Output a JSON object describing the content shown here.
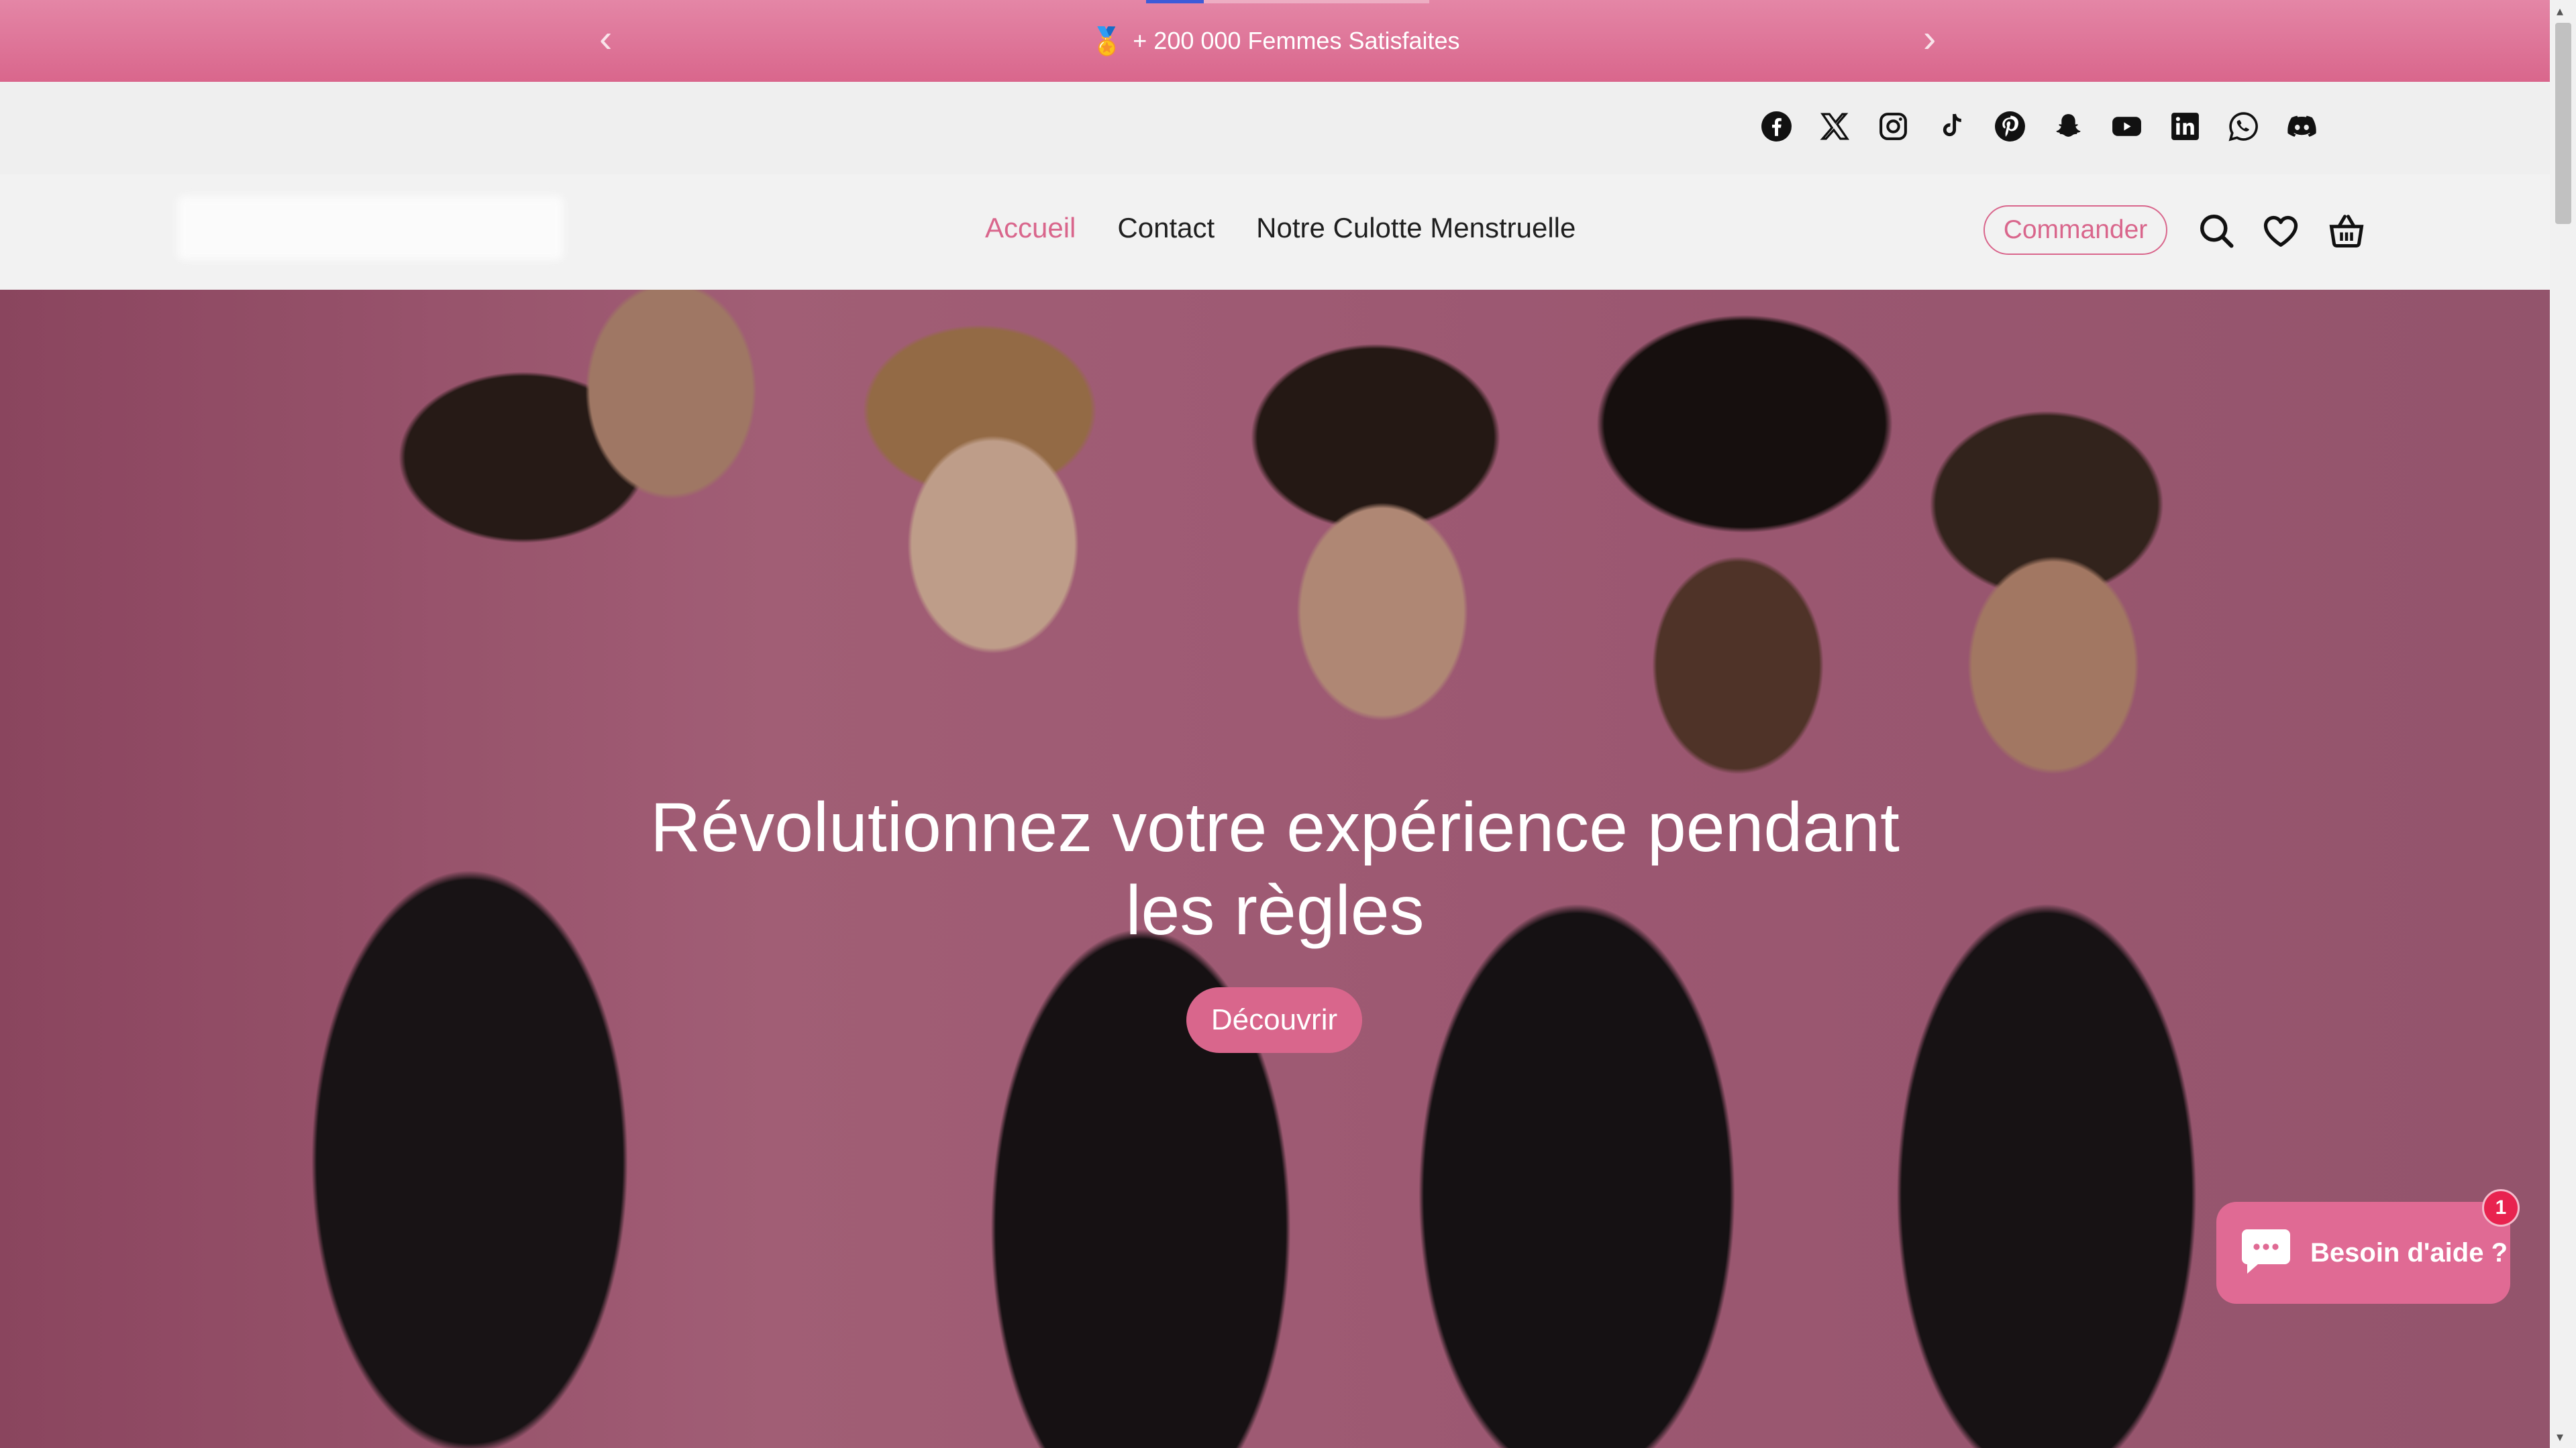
{
  "announcement": {
    "emoji": "🏅",
    "text": "+ 200 000 Femmes Satisfaites",
    "prev": "‹",
    "next": "›"
  },
  "socials": [
    "facebook-icon",
    "x-icon",
    "instagram-icon",
    "tiktok-icon",
    "pinterest-icon",
    "snapchat-icon",
    "youtube-icon",
    "linkedin-icon",
    "whatsapp-icon",
    "discord-icon"
  ],
  "nav": {
    "items": [
      {
        "label": "Accueil",
        "active": true
      },
      {
        "label": "Contact",
        "active": false
      },
      {
        "label": "Notre Culotte Menstruelle",
        "active": false
      }
    ]
  },
  "header": {
    "order_label": "Commander",
    "icons": [
      "search-icon",
      "heart-icon",
      "basket-icon"
    ]
  },
  "hero": {
    "title": "Révolutionnez votre expérience pendant les règles",
    "cta": "Découvrir"
  },
  "chat": {
    "label": "Besoin d'aide ?",
    "badge": "1"
  },
  "colors": {
    "accent": "#d9668c",
    "announce_bg": "#dd7098",
    "badge": "#e8234f"
  }
}
